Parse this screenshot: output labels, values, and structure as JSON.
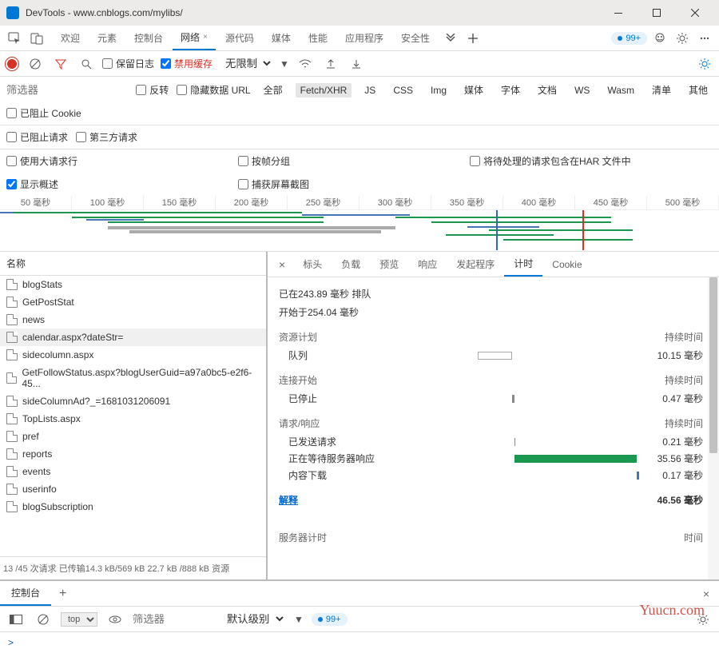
{
  "window": {
    "title": "DevTools - www.cnblogs.com/mylibs/"
  },
  "mainTabs": {
    "items": [
      "欢迎",
      "元素",
      "控制台",
      "网络",
      "源代码",
      "媒体",
      "性能",
      "应用程序",
      "安全性"
    ],
    "active": 3,
    "hasClose": [
      false,
      false,
      false,
      true,
      false,
      false,
      false,
      false,
      false
    ]
  },
  "badge": "99+",
  "toolbar2": {
    "keepLog": "保留日志",
    "disableCache": "禁用缓存",
    "throttle": "无限制"
  },
  "filterBar": {
    "placeholder": "筛选器",
    "invert": "反转",
    "hideData": "隐藏数据 URL",
    "types": [
      "全部",
      "Fetch/XHR",
      "JS",
      "CSS",
      "Img",
      "媒体",
      "字体",
      "文档",
      "WS",
      "Wasm",
      "清单",
      "其他"
    ],
    "activeType": 1,
    "blockedCookies": "已阻止 Cookie",
    "blockedReq": "已阻止请求",
    "thirdParty": "第三方请求"
  },
  "options": {
    "bigRows": "使用大请求行",
    "groupFrame": "按帧分组",
    "includeHar": "将待处理的请求包含在HAR 文件中",
    "showOverview": "显示概述",
    "screenshots": "捕获屏幕截图"
  },
  "waterfall": {
    "ticks": [
      "50 毫秒",
      "100 毫秒",
      "150 毫秒",
      "200 毫秒",
      "250 毫秒",
      "300 毫秒",
      "350 毫秒",
      "400 毫秒",
      "450 毫秒",
      "500 毫秒"
    ]
  },
  "nameCol": {
    "header": "名称",
    "items": [
      "blogStats",
      "GetPostStat",
      "news",
      "calendar.aspx?dateStr=",
      "sidecolumn.aspx",
      "GetFollowStatus.aspx?blogUserGuid=a97a0bc5-e2f6-45...",
      "sideColumnAd?_=1681031206091",
      "TopLists.aspx",
      "pref",
      "reports",
      "events",
      "userinfo",
      "blogSubscription"
    ],
    "selected": 3,
    "footer": "13 /45 次请求   已传输14.3 kB/569 kB   22.7 kB /888 kB 资源"
  },
  "detailTabs": {
    "items": [
      "标头",
      "负载",
      "预览",
      "响应",
      "发起程序",
      "计时",
      "Cookie"
    ],
    "active": 5
  },
  "timing": {
    "queued": "已在243.89 毫秒 排队",
    "started": "开始于254.04 毫秒",
    "section1": "资源计划",
    "duration": "持续时间",
    "queue": "队列",
    "queueVal": "10.15 毫秒",
    "section2": "连接开始",
    "stalled": "已停止",
    "stalledVal": "0.47 毫秒",
    "section3": "请求/响应",
    "sent": "已发送请求",
    "sentVal": "0.21 毫秒",
    "waiting": "正在等待服务器响应",
    "waitingVal": "35.56 毫秒",
    "download": "内容下载",
    "downloadVal": "0.17 毫秒",
    "explain": "解释",
    "total": "46.56 毫秒",
    "serverTiming": "服务器计时",
    "time": "时间"
  },
  "drawer": {
    "tab": "控制台",
    "top": "top",
    "filter": "筛选器",
    "level": "默认级别",
    "badge": "99+",
    "prompt": ">"
  },
  "watermark": "Yuucn.com"
}
